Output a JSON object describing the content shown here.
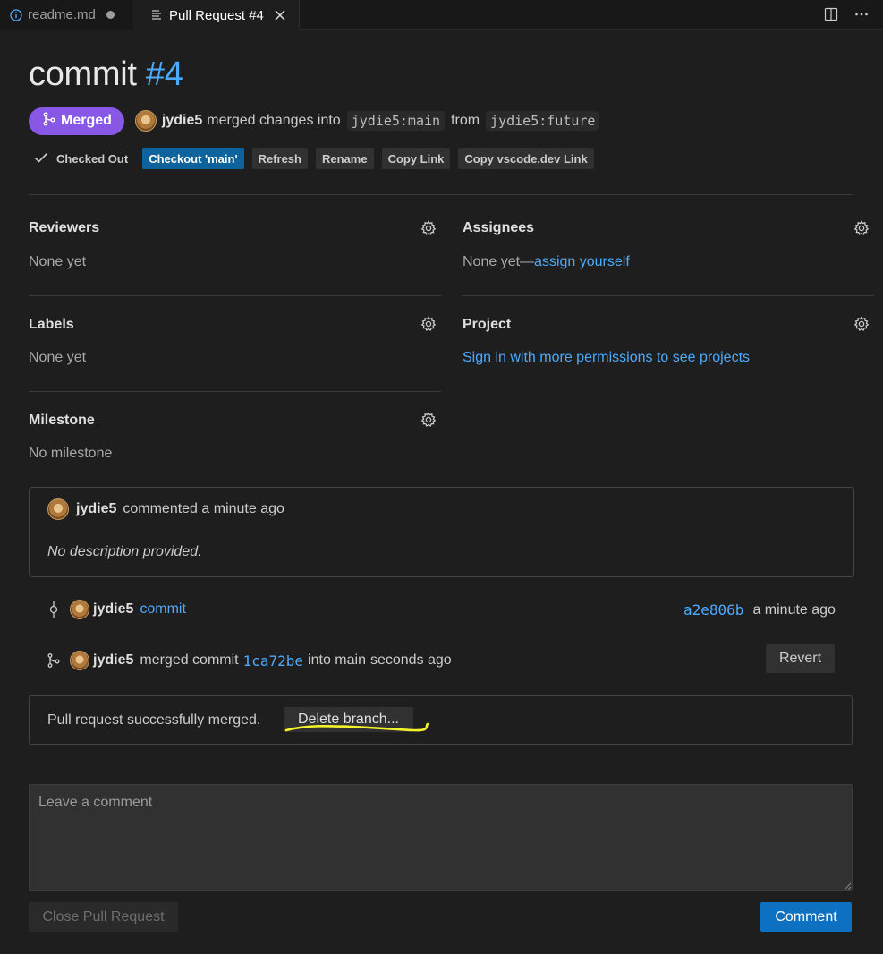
{
  "tabs": [
    {
      "label": "readme.md",
      "icon": "info-icon",
      "dirty": true
    },
    {
      "label": "Pull Request #4",
      "icon": "pull-request-icon",
      "active": true
    }
  ],
  "pr": {
    "title": "commit",
    "number": "#4",
    "status_badge": "Merged",
    "author": "jydie5",
    "merged_text": "merged changes into",
    "base_branch": "jydie5:main",
    "from_text": "from",
    "head_branch": "jydie5:future"
  },
  "actions": {
    "checked_out": "Checked Out",
    "checkout": "Checkout 'main'",
    "refresh": "Refresh",
    "rename": "Rename",
    "copy_link": "Copy Link",
    "copy_vscode_link": "Copy vscode.dev Link"
  },
  "sidebar": {
    "reviewers": {
      "label": "Reviewers",
      "value": "None yet"
    },
    "assignees": {
      "label": "Assignees",
      "value": "None yet—",
      "link": "assign yourself"
    },
    "labels": {
      "label": "Labels",
      "value": "None yet"
    },
    "project": {
      "label": "Project",
      "link": "Sign in with more permissions to see projects"
    },
    "milestone": {
      "label": "Milestone",
      "value": "No milestone"
    }
  },
  "comment": {
    "author": "jydie5",
    "action": "commented a minute ago",
    "body": "No description provided."
  },
  "timeline": {
    "commit": {
      "author": "jydie5",
      "message": "commit",
      "sha": "a2e806b",
      "time": "a minute ago"
    },
    "merge": {
      "author": "jydie5",
      "pre": "merged commit",
      "sha": "1ca72be",
      "post": "into main",
      "time": "seconds ago",
      "revert": "Revert"
    }
  },
  "merged_box": {
    "text": "Pull request successfully merged.",
    "delete_branch": "Delete branch..."
  },
  "composer": {
    "placeholder": "Leave a comment",
    "close_pr": "Close Pull Request",
    "submit": "Comment"
  },
  "colors": {
    "background": "#1e1e1e",
    "link": "#4daafc",
    "merged": "#8957e5",
    "primary_button": "#0e639c",
    "highlight": "#f3f32a"
  }
}
